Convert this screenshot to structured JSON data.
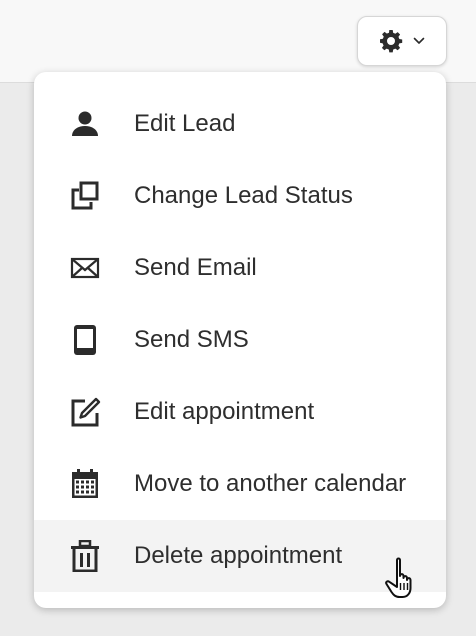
{
  "settings_button": {
    "icon": "gear-icon",
    "caret_icon": "chevron-down-icon"
  },
  "menu": {
    "hovered_index": 6,
    "items": [
      {
        "label": "Edit Lead",
        "icon": "person-icon"
      },
      {
        "label": "Change Lead Status",
        "icon": "change-status-icon"
      },
      {
        "label": "Send Email",
        "icon": "envelope-icon"
      },
      {
        "label": "Send SMS",
        "icon": "phone-icon"
      },
      {
        "label": "Edit appointment",
        "icon": "edit-icon"
      },
      {
        "label": "Move to another calendar",
        "icon": "calendar-icon"
      },
      {
        "label": "Delete appointment",
        "icon": "trash-icon"
      }
    ]
  },
  "colors": {
    "background": "#ebebeb",
    "menu_background": "#ffffff",
    "hover_background": "#f3f3f3",
    "text": "#2e2e2e",
    "icon": "#2b2b2b"
  }
}
